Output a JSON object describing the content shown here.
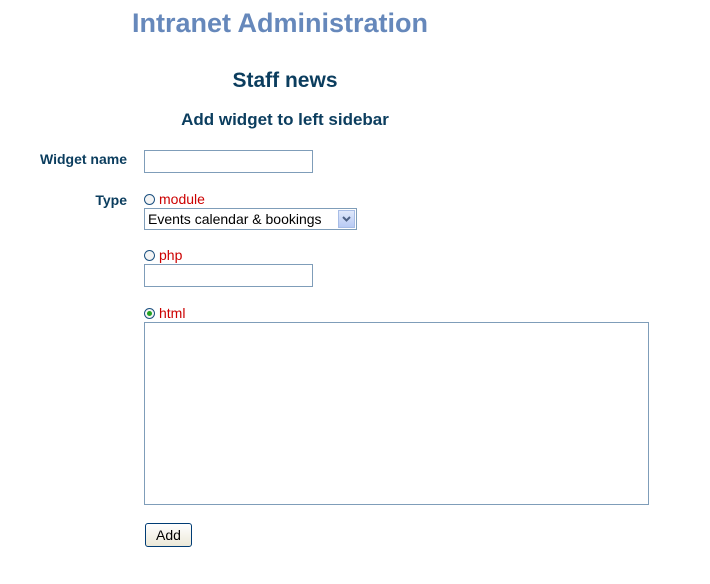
{
  "app": {
    "title": "Intranet Administration"
  },
  "page": {
    "section_title": "Staff news",
    "form_title": "Add widget to left sidebar"
  },
  "form": {
    "widget_name_label": "Widget name",
    "widget_name_value": "",
    "type_label": "Type",
    "type_options": {
      "module": {
        "label": "module",
        "checked": false
      },
      "php": {
        "label": "php",
        "checked": false
      },
      "html": {
        "label": "html",
        "checked": true
      }
    },
    "module_select_value": "Events calendar & bookings",
    "php_value": "",
    "html_value": "",
    "submit_label": "Add"
  },
  "colors": {
    "app_title": "#6688bb",
    "heading": "#0b3d5e",
    "option_label": "#cc0000",
    "radio_checked": "#21a121"
  }
}
